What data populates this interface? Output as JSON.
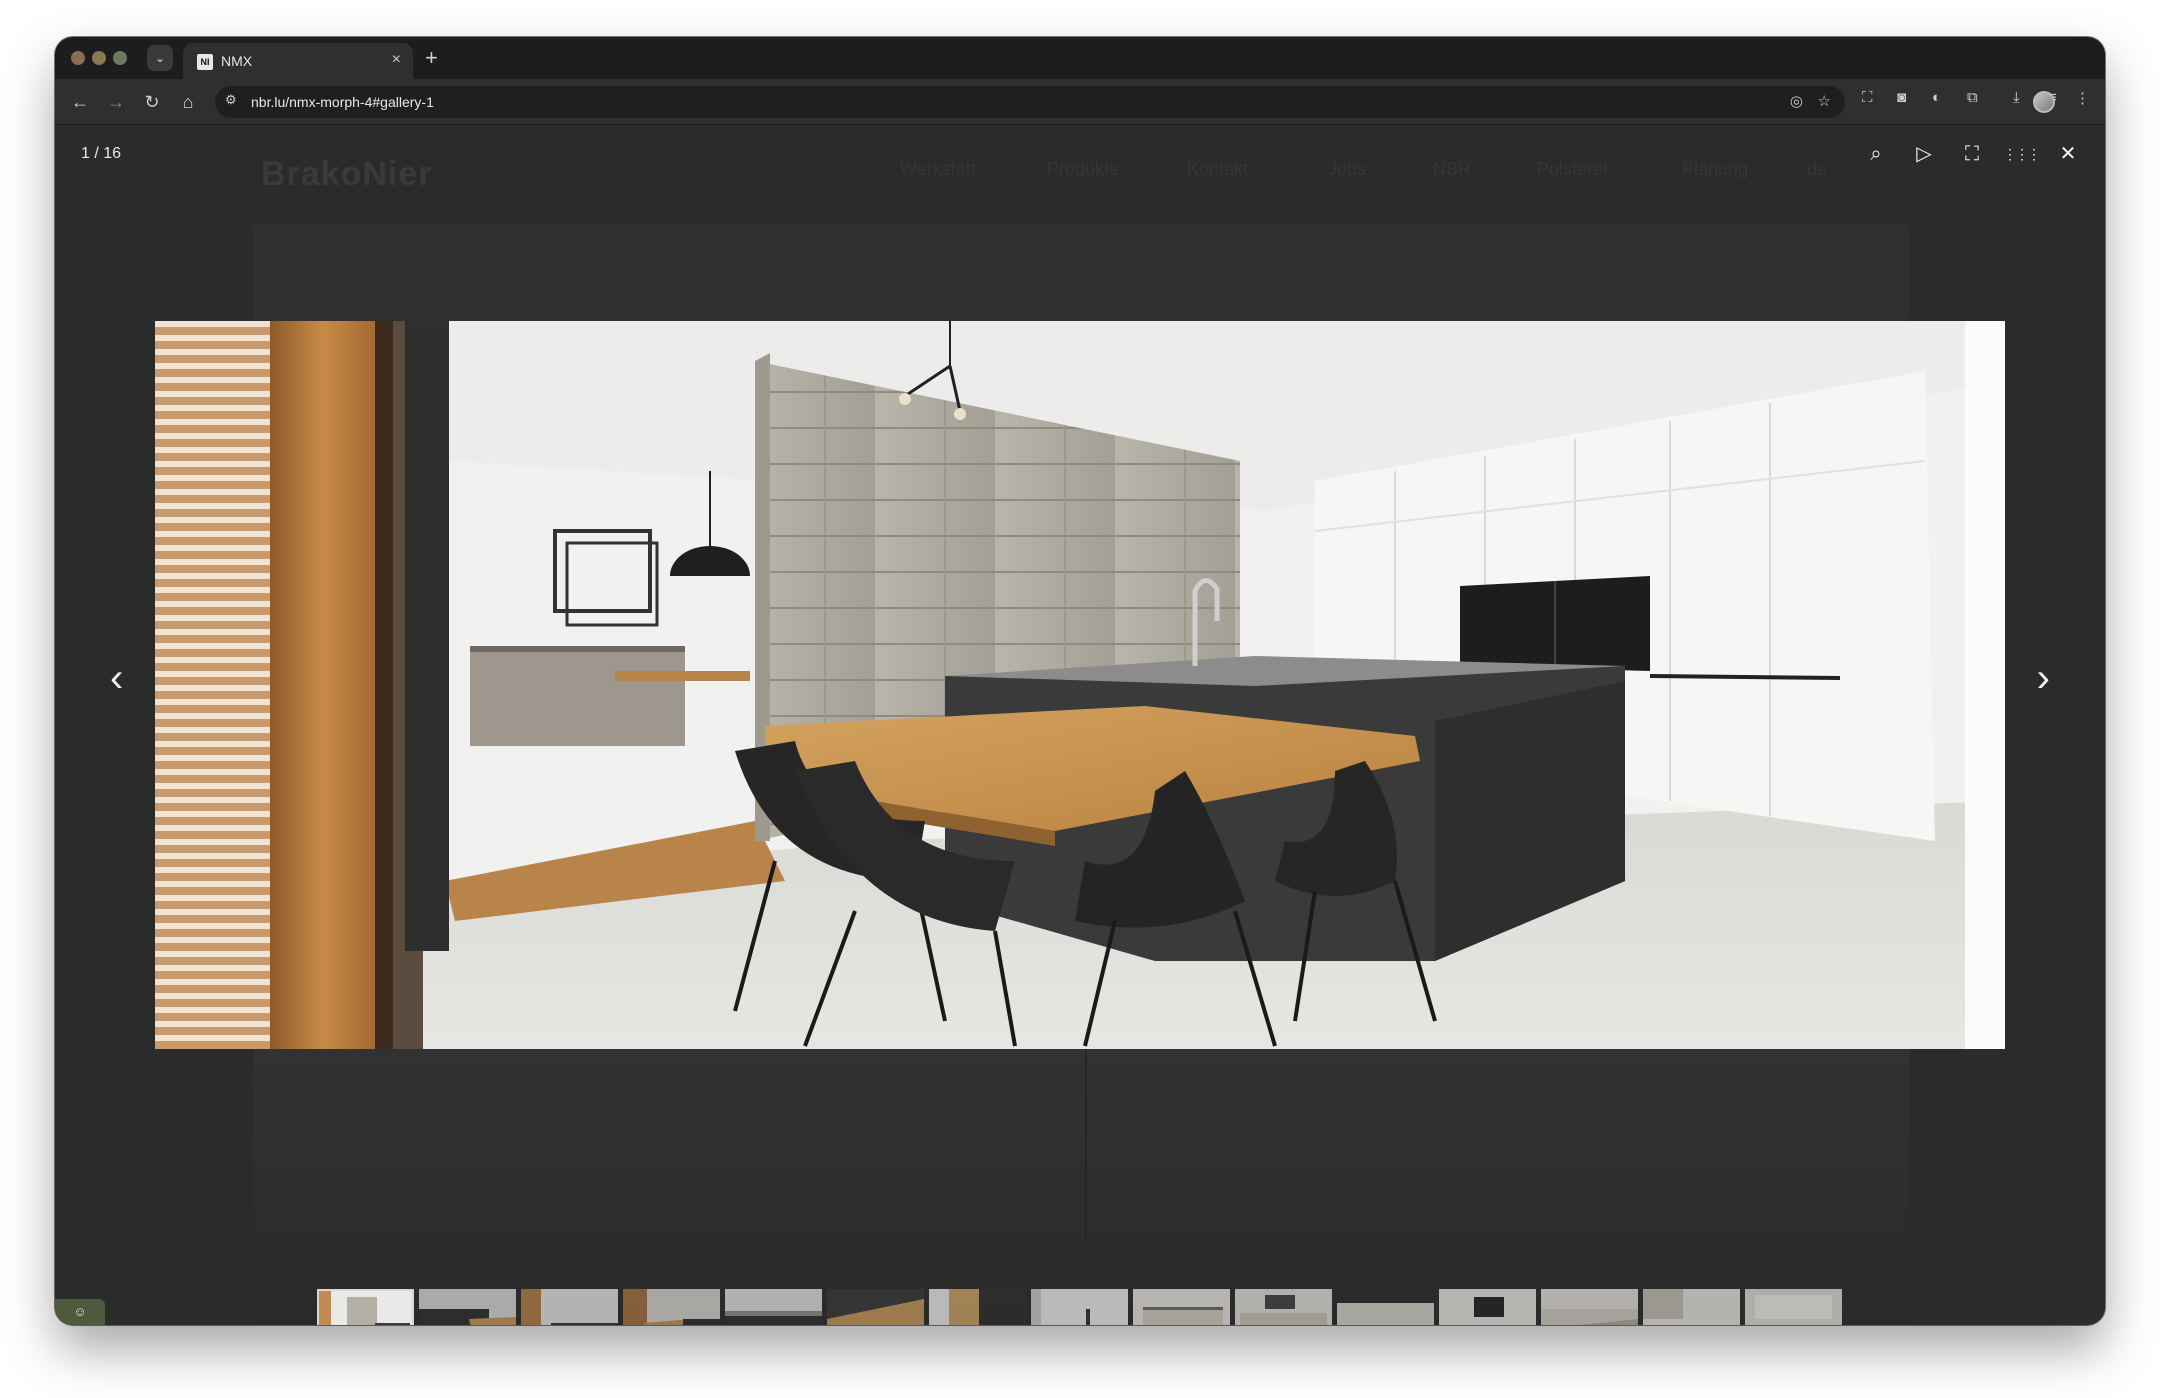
{
  "browser": {
    "tab": {
      "favicon": "NI",
      "title": "NMX",
      "close": "×"
    },
    "new_tab": "+",
    "tab_search": "⌄",
    "url": "nbr.lu/nmx-morph-4#gallery-1",
    "icons": {
      "back": "back-arrow-icon",
      "forward": "forward-arrow-icon",
      "reload": "reload-icon",
      "home": "home-icon",
      "site_info": "tune-icon",
      "eye_off": "eye-off-icon",
      "star": "star-icon"
    }
  },
  "site": {
    "logo": "BrakoNier",
    "nav": [
      "Werkstatt",
      "Produkte",
      "Kontakt",
      "Jobs",
      "NBR",
      "Polsterei",
      "Planung",
      "de"
    ]
  },
  "lightbox": {
    "counter": "1 / 16",
    "tools": [
      {
        "name": "zoom",
        "glyph": "⌕"
      },
      {
        "name": "play",
        "glyph": "▷"
      },
      {
        "name": "fullscreen",
        "glyph": "⛶"
      },
      {
        "name": "grid",
        "glyph": "⋮⋮⋮"
      },
      {
        "name": "close",
        "glyph": "✕"
      }
    ],
    "prev": "‹",
    "next": "›",
    "thumb_count": 15
  },
  "colors": {
    "overlay": "#2b2b2b",
    "accent_badge": "#4d5a3e"
  }
}
